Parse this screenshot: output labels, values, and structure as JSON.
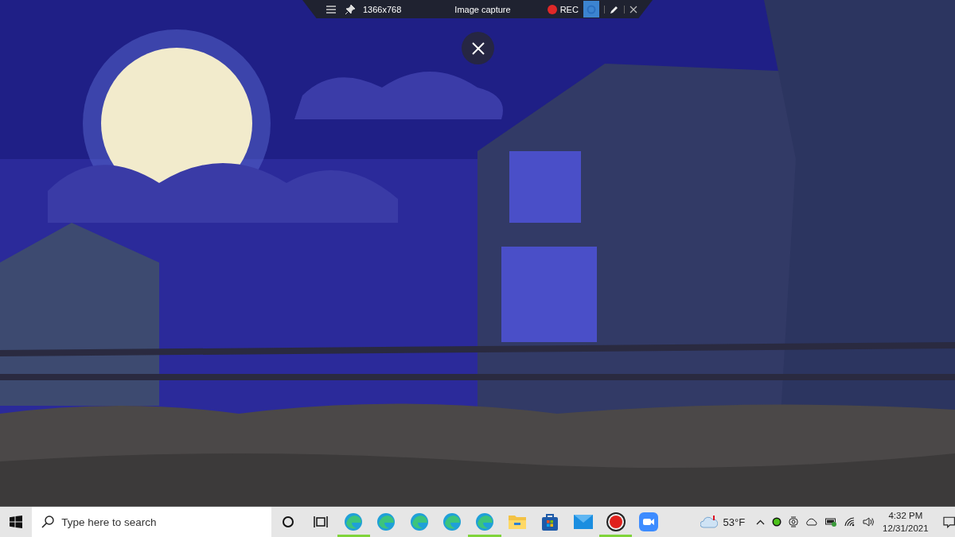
{
  "capture_toolbar": {
    "resolution": "1366x768",
    "title": "Image capture",
    "record_label": "REC",
    "camera_selected": true
  },
  "taskbar": {
    "search_placeholder": "Type here to search",
    "apps": [
      {
        "kind": "edge",
        "running": true
      },
      {
        "kind": "edge",
        "running": false
      },
      {
        "kind": "edge",
        "running": false
      },
      {
        "kind": "edge",
        "running": false
      },
      {
        "kind": "edge",
        "running": true
      },
      {
        "kind": "folder",
        "running": false
      },
      {
        "kind": "store",
        "running": false
      },
      {
        "kind": "mail",
        "running": false
      },
      {
        "kind": "recorder",
        "running": true
      },
      {
        "kind": "video-call",
        "running": false
      }
    ],
    "weather": "53°F",
    "time": "4:32 PM",
    "date": "12/31/2021"
  }
}
